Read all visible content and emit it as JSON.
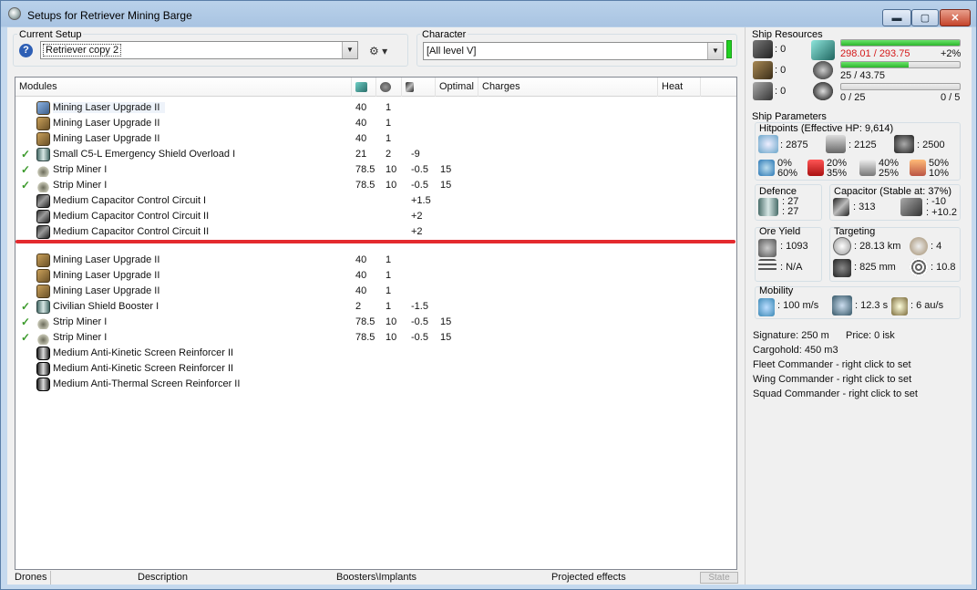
{
  "window": {
    "title": "Setups for Retriever Mining Barge",
    "min_label": "▬",
    "max_label": "▢",
    "close_label": "✕"
  },
  "current_setup": {
    "label": "Current Setup",
    "value": "Retriever copy 2",
    "help_label": "?"
  },
  "character": {
    "label": "Character",
    "value": "[All level V]"
  },
  "grid": {
    "headers": [
      "Modules",
      "Optimal",
      "Charges",
      "Heat"
    ],
    "rows_top": [
      {
        "check": "",
        "icon": "mining-laser-upgrade-icon",
        "name": "Mining Laser Upgrade II",
        "pg": "40",
        "cpu": "1",
        "cap": "",
        "opt": ""
      },
      {
        "check": "",
        "icon": "mining-laser-upgrade-icon",
        "name": "Mining Laser Upgrade II",
        "pg": "40",
        "cpu": "1",
        "cap": "",
        "opt": ""
      },
      {
        "check": "",
        "icon": "mining-laser-upgrade-icon",
        "name": "Mining Laser Upgrade II",
        "pg": "40",
        "cpu": "1",
        "cap": "",
        "opt": ""
      },
      {
        "check": "✓",
        "icon": "shield-overload-icon",
        "name": "Small C5-L Emergency Shield Overload I",
        "pg": "21",
        "cpu": "2",
        "cap": "-9",
        "opt": ""
      },
      {
        "check": "✓",
        "icon": "strip-miner-icon",
        "name": "Strip Miner I",
        "pg": "78.5",
        "cpu": "10",
        "cap": "-0.5",
        "opt": "15"
      },
      {
        "check": "✓",
        "icon": "strip-miner-icon",
        "name": "Strip Miner I",
        "pg": "78.5",
        "cpu": "10",
        "cap": "-0.5",
        "opt": "15"
      },
      {
        "check": "",
        "icon": "capacitor-circuit-icon",
        "name": "Medium Capacitor Control Circuit I",
        "pg": "",
        "cpu": "",
        "cap": "+1.5",
        "opt": ""
      },
      {
        "check": "",
        "icon": "capacitor-circuit-icon",
        "name": "Medium Capacitor Control Circuit II",
        "pg": "",
        "cpu": "",
        "cap": "+2",
        "opt": ""
      },
      {
        "check": "",
        "icon": "capacitor-circuit-icon",
        "name": "Medium Capacitor Control Circuit II",
        "pg": "",
        "cpu": "",
        "cap": "+2",
        "opt": ""
      }
    ],
    "rows_bottom": [
      {
        "check": "",
        "icon": "mining-laser-upgrade-icon",
        "name": "Mining Laser Upgrade II",
        "pg": "40",
        "cpu": "1",
        "cap": "",
        "opt": ""
      },
      {
        "check": "",
        "icon": "mining-laser-upgrade-icon",
        "name": "Mining Laser Upgrade II",
        "pg": "40",
        "cpu": "1",
        "cap": "",
        "opt": ""
      },
      {
        "check": "",
        "icon": "mining-laser-upgrade-icon",
        "name": "Mining Laser Upgrade II",
        "pg": "40",
        "cpu": "1",
        "cap": "",
        "opt": ""
      },
      {
        "check": "✓",
        "icon": "shield-booster-icon",
        "name": "Civilian Shield Booster I",
        "pg": "2",
        "cpu": "1",
        "cap": "-1.5",
        "opt": ""
      },
      {
        "check": "✓",
        "icon": "strip-miner-icon",
        "name": "Strip Miner I",
        "pg": "78.5",
        "cpu": "10",
        "cap": "-0.5",
        "opt": "15"
      },
      {
        "check": "✓",
        "icon": "strip-miner-icon",
        "name": "Strip Miner I",
        "pg": "78.5",
        "cpu": "10",
        "cap": "-0.5",
        "opt": "15"
      },
      {
        "check": "",
        "icon": "screen-reinforcer-icon",
        "name": "Medium Anti-Kinetic Screen Reinforcer II",
        "pg": "",
        "cpu": "",
        "cap": "",
        "opt": ""
      },
      {
        "check": "",
        "icon": "screen-reinforcer-icon",
        "name": "Medium Anti-Kinetic Screen Reinforcer II",
        "pg": "",
        "cpu": "",
        "cap": "",
        "opt": ""
      },
      {
        "check": "",
        "icon": "screen-reinforcer-icon",
        "name": "Medium Anti-Thermal Screen Reinforcer II",
        "pg": "",
        "cpu": "",
        "cap": "",
        "opt": ""
      }
    ]
  },
  "tabs": {
    "drones": "Drones",
    "description": "Description",
    "boosters": "Boosters\\Implants",
    "projected": "Projected effects",
    "state": "State"
  },
  "resources": {
    "label": "Ship Resources",
    "turret": ": 0",
    "launcher": ": 0",
    "drone": ": 0",
    "cpu": "298.01 / 293.75",
    "cpu_pct": "+2%",
    "cpu_fill": 1.0,
    "pg": "25 / 43.75",
    "pg_fill": 0.57,
    "calibration": "0 / 25",
    "calibration_fill": 0.0,
    "rigs": "0 / 5"
  },
  "params": {
    "label": "Ship Parameters",
    "hitpoints": "Hitpoints (Effective HP: 9,614)",
    "shield_hp": ": 2875",
    "armor_hp": ": 2125",
    "hull_hp": ": 2500",
    "res_em_a": "0%",
    "res_em_b": "60%",
    "res_th_a": "20%",
    "res_th_b": "35%",
    "res_ki_a": "40%",
    "res_ki_b": "25%",
    "res_ex_a": "50%",
    "res_ex_b": "10%",
    "defence": "Defence",
    "def_a": ": 27",
    "def_b": ": 27",
    "capacitor": "Capacitor (Stable at: 37%)",
    "cap_amount": ": 313",
    "cap_a": ": -10",
    "cap_b": ": +10.2",
    "ore_yield": "Ore Yield",
    "ore": ": 1093",
    "ore_b": ": N/A",
    "targeting": "Targeting",
    "target_range": ": 28.13 km",
    "max_targets": ": 4",
    "sig_res": ": 825 mm",
    "scan_res": ": 10.8",
    "mobility": "Mobility",
    "speed": ": 100 m/s",
    "align": ": 12.3 s",
    "warp": ": 6 au/s"
  },
  "info": {
    "signature": "Signature: 250 m",
    "price": "Price: 0 isk",
    "cargohold": "Cargohold: 450 m3",
    "fleet": "Fleet Commander - right click to set",
    "wing": "Wing Commander - right click to set",
    "squad": "Squad Commander - right click to set"
  },
  "colors": {
    "divider": "#e42a2e",
    "over_limit": "#d41a1a",
    "bar_fill": "#2db52d"
  }
}
